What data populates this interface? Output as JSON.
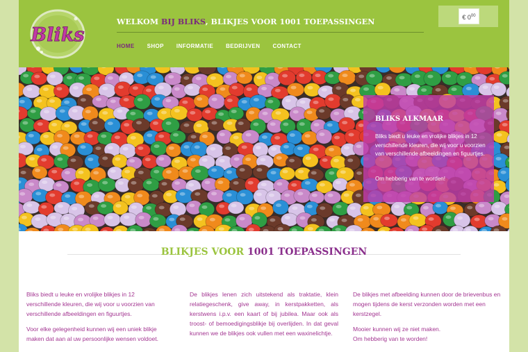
{
  "brand": {
    "logo_text": "Bliks"
  },
  "header": {
    "welcome_prefix": "WELKOM ",
    "welcome_highlight": "BIJ BLIKS",
    "welcome_suffix": ", BLIKJES VOOR 1001 TOEPASSINGEN"
  },
  "nav": {
    "items": [
      {
        "label": "HOME"
      },
      {
        "label": "SHOP"
      },
      {
        "label": "INFORMATIE"
      },
      {
        "label": "BEDRIJVEN"
      },
      {
        "label": "CONTACT"
      }
    ]
  },
  "cart": {
    "amount": "€ 0",
    "cents": "00"
  },
  "promo": {
    "title": "BLIKS ALKMAAR",
    "text": "Bliks biedt u leuke en vrolijke blikjes in 12 verschillende kleuren, die wij voor u voorzien van verschillende afbeeldingen en figuurtjes.",
    "cta": "Om hebberig van te worden!"
  },
  "section": {
    "title_green": "BLIKJES VOOR ",
    "title_purple": "1001 TOEPASSINGEN"
  },
  "columns": [
    {
      "p1": "Bliks biedt u leuke en vrolijke blikjes in 12 verschillende kleuren, die wij voor u voorzien van verschillende afbeeldingen en figuurtjes.",
      "p2": "Voor elke gelegenheid kunnen wij een uniek blikje maken dat aan al uw persoonlijke wensen voldoet."
    },
    {
      "p1": "De blikjes lenen zich uitstekend als traktatie, klein relatiegeschenk, give away, in kerstpakketten, als kerstwens i.p.v. een kaart of bij jubilea. Maar ook als troost- of bemoedigingsblikje bij overlijden. In dat geval kunnen we de blikjes ook vullen met een waxinelichtje."
    },
    {
      "p1": "De blikjes met afbeelding kunnen door de brievenbus en mogen tijdens de kerst verzonden worden met een kerstzegel.",
      "p2": "Mooier kunnen wij ze niet maken.",
      "p3": "Om hebberig van te worden!"
    }
  ],
  "colors": {
    "header_green": "#9bc43f",
    "outer_green": "#d3e3a8",
    "brand_purple": "#8a2f8c",
    "promo_magenta": "#be3caa"
  }
}
